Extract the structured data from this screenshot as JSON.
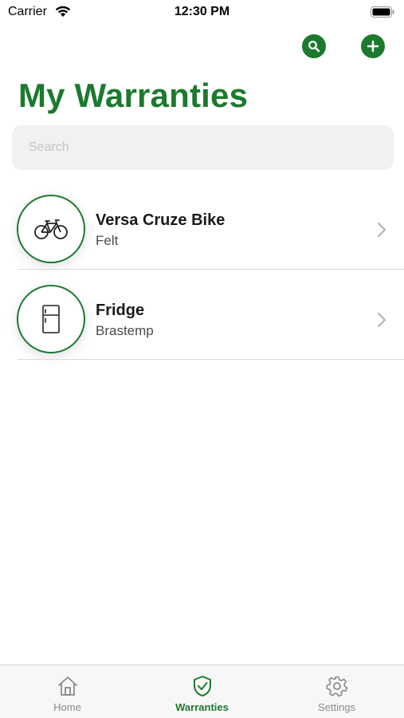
{
  "status_bar": {
    "carrier": "Carrier",
    "time": "12:30 PM"
  },
  "header": {
    "title": "My Warranties",
    "search_icon": "search-icon",
    "add_icon": "plus-icon"
  },
  "search": {
    "placeholder": "Search",
    "value": ""
  },
  "warranties": [
    {
      "name": "Versa Cruze Bike",
      "brand": "Felt",
      "icon": "bicycle-icon"
    },
    {
      "name": "Fridge",
      "brand": "Brastemp",
      "icon": "fridge-icon"
    }
  ],
  "tabs": [
    {
      "label": "Home",
      "icon": "home-icon",
      "active": false
    },
    {
      "label": "Warranties",
      "icon": "shield-check-icon",
      "active": true
    },
    {
      "label": "Settings",
      "icon": "gear-icon",
      "active": false
    }
  ],
  "colors": {
    "accent": "#1c7a2e",
    "inactive_tab": "#8a8a8a",
    "search_bg": "#f1f1f1"
  }
}
